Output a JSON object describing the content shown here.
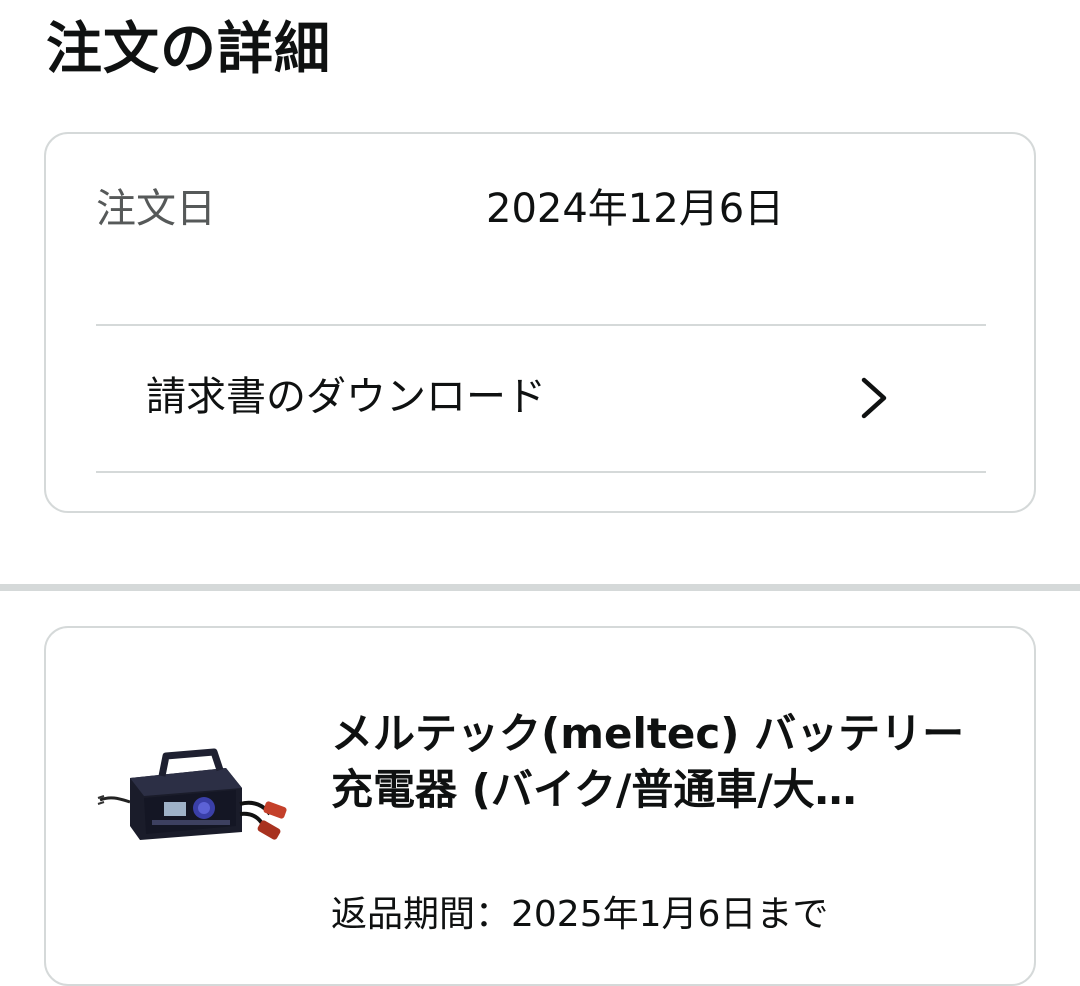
{
  "page": {
    "title": "注文の詳細"
  },
  "order_summary": {
    "order_date_label": "注文日",
    "order_date_value": "2024年12月6日",
    "invoice_download_label": "請求書のダウンロード",
    "invoice_chevron_icon": "chevron-right-icon"
  },
  "item": {
    "title": "メルテック(meltec) バッテリー充電器 (バイク/普通車/大…",
    "image_icon": "battery-charger-product-image",
    "return_window": "返品期間：2025年1月6日まで"
  },
  "colors": {
    "text_primary": "#0f1111",
    "text_secondary": "#565959",
    "border": "#d5d9d9",
    "background": "#ffffff"
  }
}
